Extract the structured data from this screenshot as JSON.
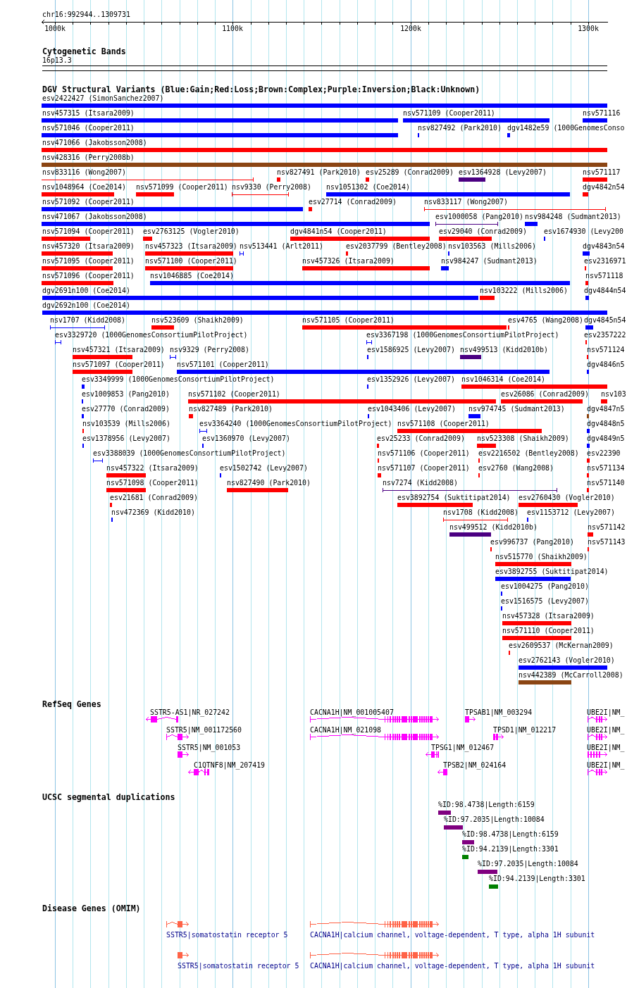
{
  "ruler": {
    "region": "chr16:992944..1309731",
    "ticks": [
      "1000k",
      "1100k",
      "1200k",
      "1300k"
    ]
  },
  "cytobands": {
    "title": "Cytogenetic Bands",
    "features": [
      {
        "label": "16p13.3"
      }
    ]
  },
  "variants": {
    "title": "DGV Structural Variants (Blue:Gain;Red:Loss;Brown:Complex;Purple:Inversion;Black:Unknown)",
    "features": [
      {
        "label": "esv2422427 (SimonSanchez2007)",
        "color": "#0000ff",
        "kind": "bar"
      },
      {
        "label": "nsv457315 (Itsara2009)",
        "color": "#0000ff",
        "kind": "bar"
      },
      {
        "label": "nsv571109 (Cooper2011)",
        "color": "#0000ff",
        "kind": "bar"
      },
      {
        "label": "nsv571116",
        "color": "#0000ff",
        "kind": "bar"
      },
      {
        "label": "nsv571046 (Cooper2011)",
        "color": "#0000ff",
        "kind": "bar"
      },
      {
        "label": "nsv827492 (Park2010)",
        "color": "#0000ff",
        "kind": "bar"
      },
      {
        "label": "dgv1482e59 (1000GenomesConso",
        "color": "#0000ff",
        "kind": "bar"
      },
      {
        "label": "nsv471066 (Jakobsson2008)",
        "color": "#ff0000",
        "kind": "bar"
      },
      {
        "label": "nsv428316 (Perry2008b)",
        "color": "#8b4513",
        "kind": "bar"
      },
      {
        "label": "nsv833116 (Wong2007)",
        "color": "#ff0000",
        "kind": "span"
      },
      {
        "label": "nsv827491 (Park2010)",
        "color": "#ff0000",
        "kind": "bar"
      },
      {
        "label": "esv25289 (Conrad2009)",
        "color": "#ff0000",
        "kind": "bar"
      },
      {
        "label": "esv1364928 (Levy2007)",
        "color": "#4b0082",
        "kind": "bar"
      },
      {
        "label": "nsv571117",
        "color": "#ff0000",
        "kind": "bar"
      },
      {
        "label": "nsv1048964 (Coe2014)",
        "color": "#ff0000",
        "kind": "bar"
      },
      {
        "label": "nsv571099 (Cooper2011)",
        "color": "#ff0000",
        "kind": "bar"
      },
      {
        "label": "nsv9330 (Perry2008)",
        "color": "#ff0000",
        "kind": "span"
      },
      {
        "label": "nsv1051302 (Coe2014)",
        "color": "#0000ff",
        "kind": "bar"
      },
      {
        "label": "dgv4842n54",
        "color": "#ff0000",
        "kind": "bar"
      },
      {
        "label": "nsv571092 (Cooper2011)",
        "color": "#0000ff",
        "kind": "bar"
      },
      {
        "label": "esv27714 (Conrad2009)",
        "color": "#ff0000",
        "kind": "bar"
      },
      {
        "label": "nsv833117 (Wong2007)",
        "color": "#ff0000",
        "kind": "span"
      },
      {
        "label": "nsv471067 (Jakobsson2008)",
        "color": "#0000ff",
        "kind": "bar"
      },
      {
        "label": "esv1000058 (Pang2010)",
        "color": "#4b0082",
        "kind": "span"
      },
      {
        "label": "nsv984248 (Sudmant2013)",
        "color": "#0000ff",
        "kind": "bar"
      },
      {
        "label": "nsv571094 (Cooper2011)",
        "color": "#ff0000",
        "kind": "bar"
      },
      {
        "label": "esv2763125 (Vogler2010)",
        "color": "#ff0000",
        "kind": "bar"
      },
      {
        "label": "dgv4841n54 (Cooper2011)",
        "color": "#ff0000",
        "kind": "bar"
      },
      {
        "label": "esv29040 (Conrad2009)",
        "color": "#ff0000",
        "kind": "bar"
      },
      {
        "label": "esv1674930 (Levy200",
        "color": "#0000ff",
        "kind": "bar"
      },
      {
        "label": "nsv457320 (Itsara2009)",
        "color": "#ff0000",
        "kind": "bar"
      },
      {
        "label": "nsv457323 (Itsara2009)",
        "color": "#ff0000",
        "kind": "bar"
      },
      {
        "label": "nsv513441 (Arlt2011)",
        "color": "#0000ff",
        "kind": "span"
      },
      {
        "label": "esv2037799 (Bentley2008)",
        "color": "#ff0000",
        "kind": "bar"
      },
      {
        "label": "nsv103563 (Mills2006)",
        "color": "#0000ff",
        "kind": "bar"
      },
      {
        "label": "dgv4843n54",
        "color": "#0000ff",
        "kind": "bar"
      },
      {
        "label": "nsv571095 (Cooper2011)",
        "color": "#ff0000",
        "kind": "bar"
      },
      {
        "label": "nsv571100 (Cooper2011)",
        "color": "#ff0000",
        "kind": "bar"
      },
      {
        "label": "nsv457326 (Itsara2009)",
        "color": "#ff0000",
        "kind": "bar"
      },
      {
        "label": "nsv984247 (Sudmant2013)",
        "color": "#0000ff",
        "kind": "bar"
      },
      {
        "label": "esv2316971",
        "color": "#ff0000",
        "kind": "bar"
      },
      {
        "label": "nsv571096 (Cooper2011)",
        "color": "#ff0000",
        "kind": "bar"
      },
      {
        "label": "nsv1046885 (Coe2014)",
        "color": "#0000ff",
        "kind": "bar"
      },
      {
        "label": "nsv571118",
        "color": "#ff0000",
        "kind": "bar"
      },
      {
        "label": "dgv2691n100 (Coe2014)",
        "color": "#0000ff",
        "kind": "bar"
      },
      {
        "label": "nsv103222 (Mills2006)",
        "color": "#ff0000",
        "kind": "bar"
      },
      {
        "label": "dgv4844n54",
        "color": "#0000ff",
        "kind": "bar"
      },
      {
        "label": "dgv2692n100 (Coe2014)",
        "color": "#0000ff",
        "kind": "bar"
      },
      {
        "label": "nsv1707 (Kidd2008)",
        "color": "#0000ff",
        "kind": "span"
      },
      {
        "label": "nsv523609 (Shaikh2009)",
        "color": "#ff0000",
        "kind": "bar"
      },
      {
        "label": "nsv571105 (Cooper2011)",
        "color": "#ff0000",
        "kind": "bar"
      },
      {
        "label": "esv4765 (Wang2008)",
        "color": "#ff0000",
        "kind": "bar"
      },
      {
        "label": "dgv4845n54",
        "color": "#0000ff",
        "kind": "bar"
      },
      {
        "label": "esv3329720 (1000GenomesConsortiumPilotProject)",
        "color": "#0000ff",
        "kind": "span"
      },
      {
        "label": "esv3367198 (1000GenomesConsortiumPilotProject)",
        "color": "#0000ff",
        "kind": "span"
      },
      {
        "label": "esv2357222",
        "color": "#ff0000",
        "kind": "bar"
      },
      {
        "label": "nsv457321 (Itsara2009)",
        "color": "#ff0000",
        "kind": "bar"
      },
      {
        "label": "nsv9329 (Perry2008)",
        "color": "#0000ff",
        "kind": "span"
      },
      {
        "label": "esv1586925 (Levy2007)",
        "color": "#0000ff",
        "kind": "bar"
      },
      {
        "label": "nsv499513 (Kidd2010b)",
        "color": "#4b0082",
        "kind": "bar"
      },
      {
        "label": "nsv571124",
        "color": "#ff0000",
        "kind": "bar"
      },
      {
        "label": "nsv571097 (Cooper2011)",
        "color": "#ff0000",
        "kind": "bar"
      },
      {
        "label": "nsv571101 (Cooper2011)",
        "color": "#0000ff",
        "kind": "bar"
      },
      {
        "label": "dgv4846n5",
        "color": "#0000ff",
        "kind": "bar"
      },
      {
        "label": "esv3349999 (1000GenomesConsortiumPilotProject)",
        "color": "#0000ff",
        "kind": "bar"
      },
      {
        "label": "esv1352926 (Levy2007)",
        "color": "#0000ff",
        "kind": "bar"
      },
      {
        "label": "nsv1046314 (Coe2014)",
        "color": "#ff0000",
        "kind": "bar"
      },
      {
        "label": "esv1009853 (Pang2010)",
        "color": "#0000ff",
        "kind": "bar"
      },
      {
        "label": "nsv571102 (Cooper2011)",
        "color": "#ff0000",
        "kind": "bar"
      },
      {
        "label": "esv26086 (Conrad2009)",
        "color": "#ff0000",
        "kind": "bar"
      },
      {
        "label": "nsv103",
        "color": "#ff0000",
        "kind": "bar"
      },
      {
        "label": "esv27770 (Conrad2009)",
        "color": "#0000ff",
        "kind": "bar"
      },
      {
        "label": "nsv827489 (Park2010)",
        "color": "#ff0000",
        "kind": "bar"
      },
      {
        "label": "esv1043406 (Levy2007)",
        "color": "#0000ff",
        "kind": "bar"
      },
      {
        "label": "nsv974745 (Sudmant2013)",
        "color": "#0000ff",
        "kind": "bar"
      },
      {
        "label": "dgv4847n5",
        "color": "#8b4513",
        "kind": "bar"
      },
      {
        "label": "nsv103539 (Mills2006)",
        "color": "#ff0000",
        "kind": "bar"
      },
      {
        "label": "esv3364240 (1000GenomesConsortiumPilotProject)",
        "color": "#0000ff",
        "kind": "span"
      },
      {
        "label": "nsv571108 (Cooper2011)",
        "color": "#ff0000",
        "kind": "bar"
      },
      {
        "label": "dgv4848n5",
        "color": "#0000ff",
        "kind": "bar"
      },
      {
        "label": "esv1378956 (Levy2007)",
        "color": "#0000ff",
        "kind": "bar"
      },
      {
        "label": "esv1360970 (Levy2007)",
        "color": "#0000ff",
        "kind": "bar"
      },
      {
        "label": "esv25233 (Conrad2009)",
        "color": "#ff0000",
        "kind": "bar"
      },
      {
        "label": "nsv523308 (Shaikh2009)",
        "color": "#ff0000",
        "kind": "bar"
      },
      {
        "label": "dgv4849n5",
        "color": "#0000ff",
        "kind": "bar"
      },
      {
        "label": "esv3388039 (1000GenomesConsortiumPilotProject)",
        "color": "#0000ff",
        "kind": "span"
      },
      {
        "label": "nsv571106 (Cooper2011)",
        "color": "#ff0000",
        "kind": "bar"
      },
      {
        "label": "esv2216502 (Bentley2008)",
        "color": "#ff0000",
        "kind": "bar"
      },
      {
        "label": "esv22390",
        "color": "#ff0000",
        "kind": "bar"
      },
      {
        "label": "nsv457322 (Itsara2009)",
        "color": "#ff0000",
        "kind": "bar"
      },
      {
        "label": "esv1502742 (Levy2007)",
        "color": "#0000ff",
        "kind": "bar"
      },
      {
        "label": "nsv571107 (Cooper2011)",
        "color": "#ff0000",
        "kind": "bar"
      },
      {
        "label": "esv2760 (Wang2008)",
        "color": "#ff0000",
        "kind": "bar"
      },
      {
        "label": "nsv571134",
        "color": "#ff0000",
        "kind": "bar"
      },
      {
        "label": "nsv571098 (Cooper2011)",
        "color": "#ff0000",
        "kind": "bar"
      },
      {
        "label": "nsv827490 (Park2010)",
        "color": "#ff0000",
        "kind": "bar"
      },
      {
        "label": "nsv7274 (Kidd2008)",
        "color": "#4b0082",
        "kind": "span"
      },
      {
        "label": "nsv571140",
        "color": "#ff0000",
        "kind": "bar"
      },
      {
        "label": "esv21681 (Conrad2009)",
        "color": "#ff0000",
        "kind": "bar"
      },
      {
        "label": "esv3892754 (Suktitipat2014)",
        "color": "#ff0000",
        "kind": "bar"
      },
      {
        "label": "esv2760430 (Vogler2010)",
        "color": "#ff0000",
        "kind": "bar"
      },
      {
        "label": "nsv472369 (Kidd2010)",
        "color": "#0000ff",
        "kind": "bar"
      },
      {
        "label": "nsv1708 (Kidd2008)",
        "color": "#ff0000",
        "kind": "span"
      },
      {
        "label": "esv1153712 (Levy2007)",
        "color": "#0000ff",
        "kind": "bar"
      },
      {
        "label": "nsv499512 (Kidd2010b)",
        "color": "#4b0082",
        "kind": "bar"
      },
      {
        "label": "nsv571142",
        "color": "#ff0000",
        "kind": "bar"
      },
      {
        "label": "esv996737 (Pang2010)",
        "color": "#ff0000",
        "kind": "bar"
      },
      {
        "label": "nsv571143",
        "color": "#ff0000",
        "kind": "bar"
      },
      {
        "label": "nsv515770 (Shaikh2009)",
        "color": "#ff0000",
        "kind": "bar"
      },
      {
        "label": "esv3892755 (Suktitipat2014)",
        "color": "#0000ff",
        "kind": "bar"
      },
      {
        "label": "esv1004275 (Pang2010)",
        "color": "#0000ff",
        "kind": "bar"
      },
      {
        "label": "esv1516575 (Levy2007)",
        "color": "#0000ff",
        "kind": "bar"
      },
      {
        "label": "nsv457328 (Itsara2009)",
        "color": "#ff0000",
        "kind": "bar"
      },
      {
        "label": "nsv571110 (Cooper2011)",
        "color": "#ff0000",
        "kind": "bar"
      },
      {
        "label": "esv2609537 (McKernan2009)",
        "color": "#ff0000",
        "kind": "bar"
      },
      {
        "label": "esv2762143 (Vogler2010)",
        "color": "#0000ff",
        "kind": "bar"
      },
      {
        "label": "nsv442389 (McCarroll2008)",
        "color": "#8b4513",
        "kind": "bar"
      }
    ]
  },
  "genes": {
    "title": "RefSeq Genes",
    "features": [
      {
        "label": "SSTR5-AS1|NR_027242",
        "reverse": true
      },
      {
        "label": "CACNA1H|NM_001005407",
        "reverse": false
      },
      {
        "label": "TPSAB1|NM_003294",
        "reverse": false
      },
      {
        "label": "UBE2I|NM_",
        "reverse": false
      },
      {
        "label": "SSTR5|NM_001172560",
        "reverse": false
      },
      {
        "label": "CACNA1H|NM_021098",
        "reverse": false
      },
      {
        "label": "TPSD1|NM_012217",
        "reverse": false
      },
      {
        "label": "UBE2I|NM_",
        "reverse": false
      },
      {
        "label": "SSTR5|NM_001053",
        "reverse": false
      },
      {
        "label": "TPSG1|NM_012467",
        "reverse": true
      },
      {
        "label": "UBE2I|NM_",
        "reverse": false
      },
      {
        "label": "C1QTNF8|NM_207419",
        "reverse": true
      },
      {
        "label": "TPSB2|NM_024164",
        "reverse": true
      },
      {
        "label": "UBE2I|NM_",
        "reverse": false
      }
    ]
  },
  "segdups": {
    "title": "UCSC segmental duplications",
    "features": [
      {
        "label": "%ID:98.4738|Length:6159",
        "color": "#800080"
      },
      {
        "label": "%ID:97.2035|Length:10084",
        "color": "#800080"
      },
      {
        "label": "%ID:98.4738|Length:6159",
        "color": "#800080"
      },
      {
        "label": "%ID:94.2139|Length:3301",
        "color": "#008000"
      },
      {
        "label": "%ID:97.2035|Length:10084",
        "color": "#800080"
      },
      {
        "label": "%ID:94.2139|Length:3301",
        "color": "#008000"
      }
    ]
  },
  "disease": {
    "title": "Disease Genes (OMIM)",
    "features": [
      {
        "label": "SSTR5|somatostatin receptor 5",
        "reverse": false
      },
      {
        "label": "CACNA1H|calcium channel, voltage-dependent, T type, alpha 1H subunit",
        "reverse": false
      },
      {
        "label": "SSTR5|somatostatin receptor 5",
        "reverse": false
      },
      {
        "label": "CACNA1H|calcium channel, voltage-dependent, T type, alpha 1H subunit",
        "reverse": false
      }
    ]
  }
}
